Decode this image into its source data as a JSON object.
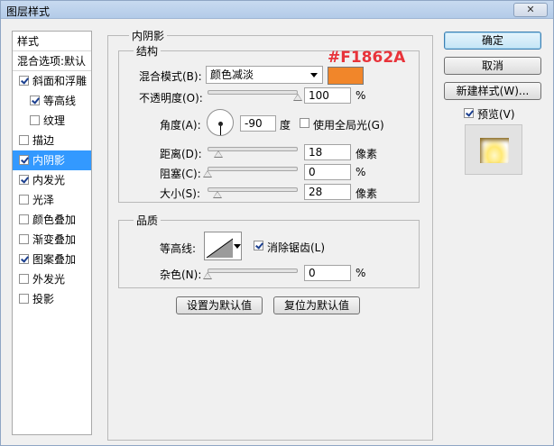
{
  "window": {
    "title": "图层样式",
    "close_label": "✕"
  },
  "styles": {
    "header": "样式",
    "blend_options": "混合选项:默认",
    "items": [
      {
        "label": "斜面和浮雕",
        "checked": true,
        "indent": 0
      },
      {
        "label": "等高线",
        "checked": true,
        "indent": 1
      },
      {
        "label": "纹理",
        "checked": false,
        "indent": 1
      },
      {
        "label": "描边",
        "checked": false,
        "indent": 0
      },
      {
        "label": "内阴影",
        "checked": true,
        "indent": 0,
        "selected": true
      },
      {
        "label": "内发光",
        "checked": true,
        "indent": 0
      },
      {
        "label": "光泽",
        "checked": false,
        "indent": 0
      },
      {
        "label": "颜色叠加",
        "checked": false,
        "indent": 0
      },
      {
        "label": "渐变叠加",
        "checked": false,
        "indent": 0
      },
      {
        "label": "图案叠加",
        "checked": true,
        "indent": 0
      },
      {
        "label": "外发光",
        "checked": false,
        "indent": 0
      },
      {
        "label": "投影",
        "checked": false,
        "indent": 0
      }
    ]
  },
  "inner_shadow": {
    "title": "内阴影",
    "structure": {
      "title": "结构",
      "blend_mode_label": "混合模式(B):",
      "blend_mode_value": "颜色减淡",
      "color": "#F1862A",
      "opacity_label": "不透明度(O):",
      "opacity_value": "100",
      "opacity_fraction": 1.0,
      "percent": "%",
      "angle_label": "角度(A):",
      "angle_value": "-90",
      "degree": "度",
      "global_light_label": "使用全局光(G)",
      "global_light_checked": false,
      "distance_label": "距离(D):",
      "distance_value": "18",
      "distance_fraction": 0.12,
      "choke_label": "阻塞(C):",
      "choke_value": "0",
      "choke_fraction": 0.0,
      "size_label": "大小(S):",
      "size_value": "28",
      "size_fraction": 0.11,
      "pixel_unit": "像素"
    },
    "quality": {
      "title": "品质",
      "contour_label": "等高线:",
      "anti_alias_label": "消除锯齿(L)",
      "anti_alias_checked": true,
      "noise_label": "杂色(N):",
      "noise_value": "0",
      "noise_fraction": 0.0
    },
    "set_default_label": "设置为默认值",
    "reset_default_label": "复位为默认值"
  },
  "annotation": {
    "text": "#F1862A",
    "color": "#e8333a"
  },
  "buttons": {
    "ok": "确定",
    "cancel": "取消",
    "new_style": "新建样式(W)...",
    "preview": "预览(V)",
    "preview_checked": true
  }
}
